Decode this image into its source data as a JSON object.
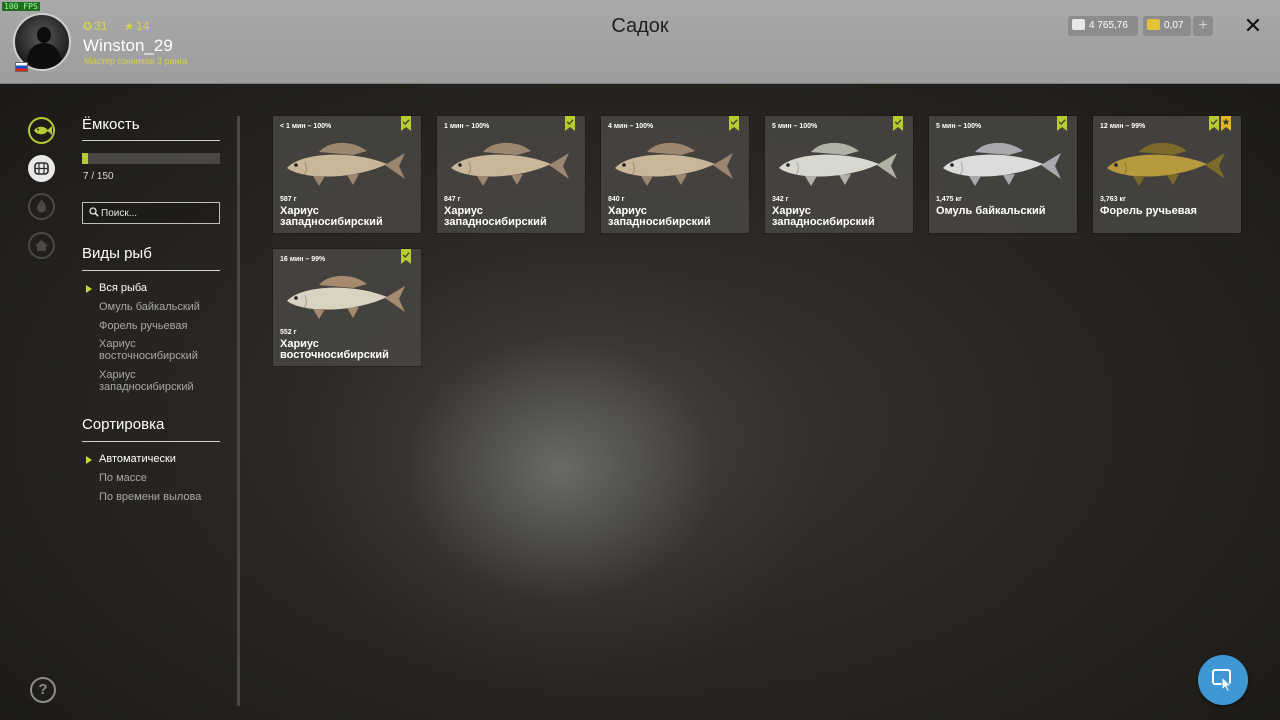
{
  "overlay": {
    "fps": "100 FPS"
  },
  "header": {
    "title": "Садок",
    "user": {
      "name": "Winston_29",
      "coins": "31",
      "stars": "14",
      "rank_line": "Мастер гонников 3 ранга"
    },
    "currency": {
      "silver": "4 765,76",
      "gold": "0,07"
    },
    "plus_label": "+",
    "close_label": "✕"
  },
  "sidebar": {
    "icons": [
      "fish-icon",
      "cage-icon",
      "fire-icon",
      "house-icon"
    ],
    "help_label": "?"
  },
  "capacity": {
    "title": "Ёмкость",
    "text": "7 / 150",
    "fill_fraction": 0.047
  },
  "search": {
    "placeholder": "Поиск..."
  },
  "species": {
    "title": "Виды рыб",
    "items": [
      "Вся рыба",
      "Омуль байкальский",
      "Форель ручьевая",
      "Хариус восточносибирский",
      "Хариус западносибирский"
    ],
    "active_index": 0
  },
  "sorting": {
    "title": "Сортировка",
    "items": [
      "Автоматически",
      "По массе",
      "По времени вылова"
    ],
    "active_index": 0
  },
  "fish": [
    {
      "catch": "< 1 мин – 100%",
      "weight": "587 г",
      "name": "Хариус западносибирский",
      "color": "#c9b79a",
      "fin": "#9c8670",
      "star": false
    },
    {
      "catch": "1 мин – 100%",
      "weight": "847 г",
      "name": "Хариус западносибирский",
      "color": "#c9b79a",
      "fin": "#9c8670",
      "star": false
    },
    {
      "catch": "4 мин – 100%",
      "weight": "840 г",
      "name": "Хариус западносибирский",
      "color": "#c9b79a",
      "fin": "#9c8670",
      "star": false
    },
    {
      "catch": "5 мин – 100%",
      "weight": "342 г",
      "name": "Хариус западносибирский",
      "color": "#d8d8cf",
      "fin": "#b0b2a6",
      "star": false
    },
    {
      "catch": "5 мин – 100%",
      "weight": "1,475 кг",
      "name": "Омуль байкальский",
      "color": "#dcdcdc",
      "fin": "#a9aab0",
      "star": false
    },
    {
      "catch": "12 мин – 99%",
      "weight": "3,763 кг",
      "name": "Форель ручьевая",
      "color": "#b79a3e",
      "fin": "#7c6a2a",
      "star": true
    },
    {
      "catch": "16 мин – 99%",
      "weight": "552 г",
      "name": "Хариус восточносибирский",
      "color": "#d9d3c2",
      "fin": "#a58a70",
      "star": false
    }
  ],
  "colors": {
    "accent": "#c7d63a",
    "bookmark": "#b9cc2d",
    "star_bookmark": "#e3b51e",
    "fab": "#3f97d4"
  }
}
